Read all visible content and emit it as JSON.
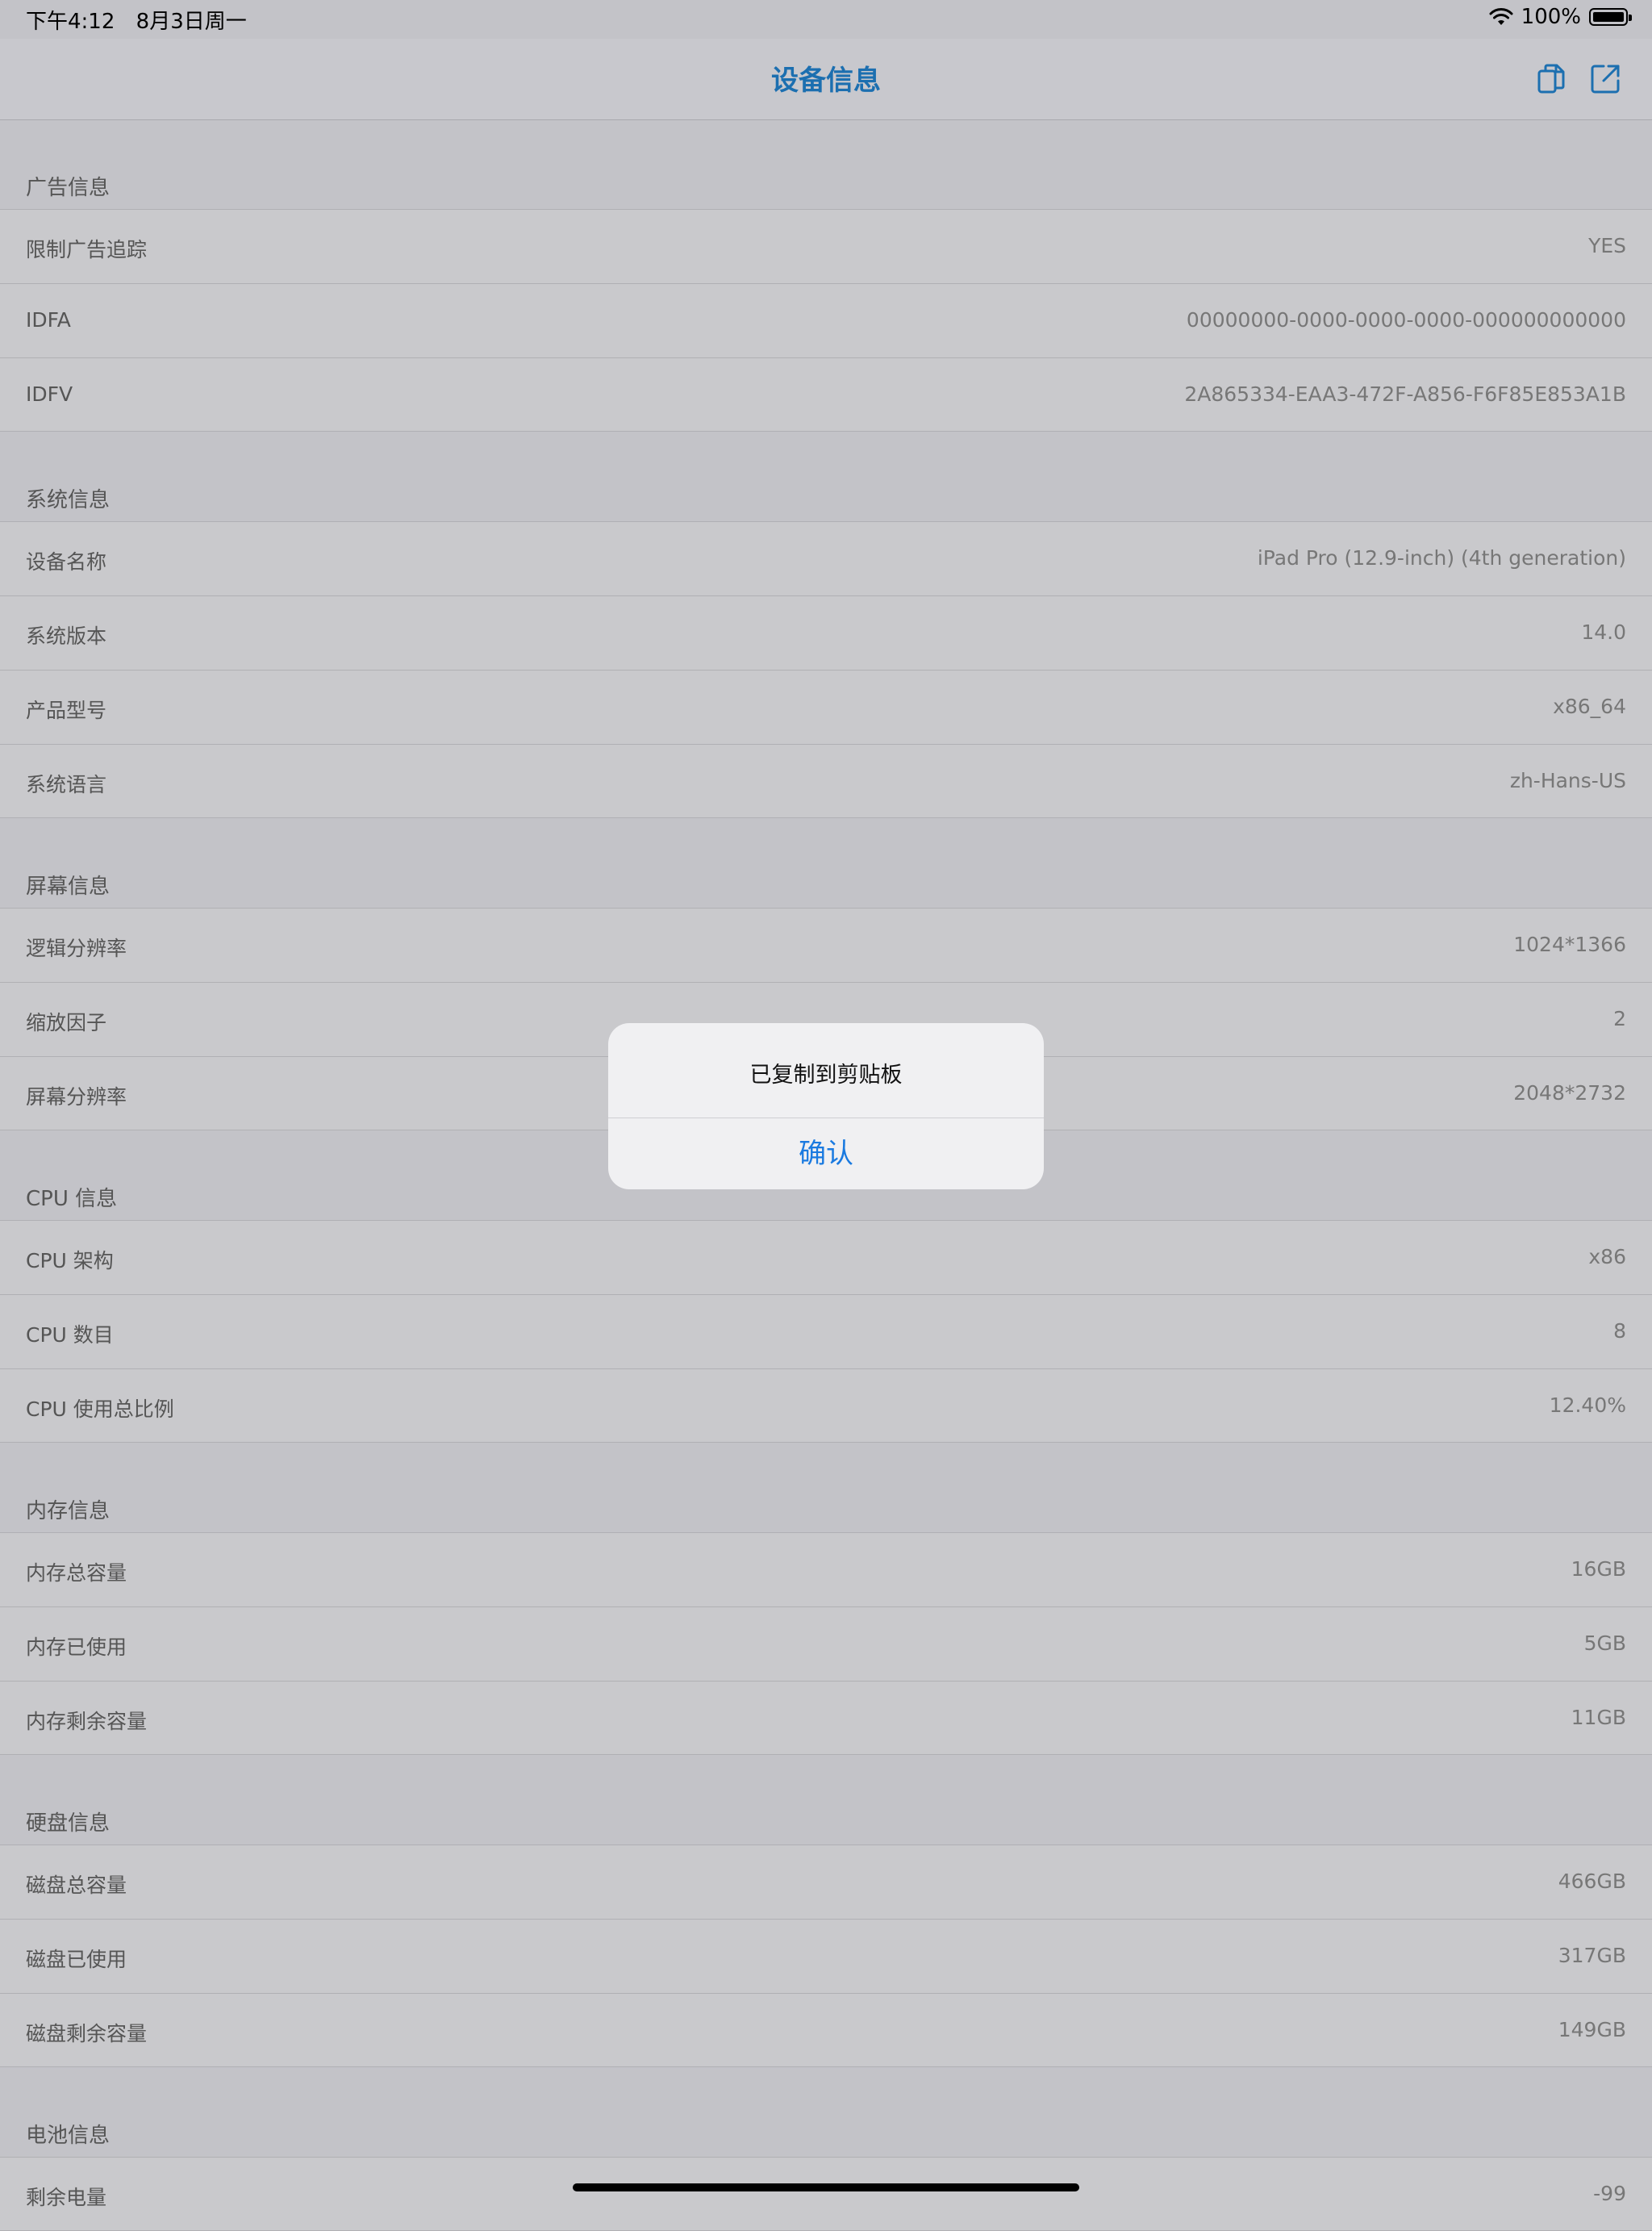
{
  "status": {
    "time": "下午4:12",
    "date": "8月3日周一",
    "battery": "100%"
  },
  "nav": {
    "title": "设备信息",
    "copy_icon": "copy-icon",
    "share_icon": "share-icon"
  },
  "sections": [
    {
      "title": "广告信息",
      "rows": [
        {
          "label": "限制广告追踪",
          "value": "YES"
        },
        {
          "label": "IDFA",
          "value": "00000000-0000-0000-0000-000000000000"
        },
        {
          "label": "IDFV",
          "value": "2A865334-EAA3-472F-A856-F6F85E853A1B"
        }
      ]
    },
    {
      "title": "系统信息",
      "rows": [
        {
          "label": "设备名称",
          "value": "iPad Pro (12.9-inch) (4th generation)"
        },
        {
          "label": "系统版本",
          "value": "14.0"
        },
        {
          "label": "产品型号",
          "value": "x86_64"
        },
        {
          "label": "系统语言",
          "value": "zh-Hans-US"
        }
      ]
    },
    {
      "title": "屏幕信息",
      "rows": [
        {
          "label": "逻辑分辨率",
          "value": "1024*1366"
        },
        {
          "label": "缩放因子",
          "value": "2"
        },
        {
          "label": "屏幕分辨率",
          "value": "2048*2732"
        }
      ]
    },
    {
      "title": "CPU 信息",
      "rows": [
        {
          "label": "CPU 架构",
          "value": "x86"
        },
        {
          "label": "CPU 数目",
          "value": "8"
        },
        {
          "label": "CPU 使用总比例",
          "value": "12.40%"
        }
      ]
    },
    {
      "title": "内存信息",
      "rows": [
        {
          "label": "内存总容量",
          "value": "16GB"
        },
        {
          "label": "内存已使用",
          "value": "5GB"
        },
        {
          "label": "内存剩余容量",
          "value": "11GB"
        }
      ]
    },
    {
      "title": "硬盘信息",
      "rows": [
        {
          "label": "磁盘总容量",
          "value": "466GB"
        },
        {
          "label": "磁盘已使用",
          "value": "317GB"
        },
        {
          "label": "磁盘剩余容量",
          "value": "149GB"
        }
      ]
    },
    {
      "title": "电池信息",
      "rows": [
        {
          "label": "剩余电量",
          "value": "-99"
        }
      ]
    }
  ],
  "alert": {
    "message": "已复制到剪贴板",
    "confirm_label": "确认"
  }
}
